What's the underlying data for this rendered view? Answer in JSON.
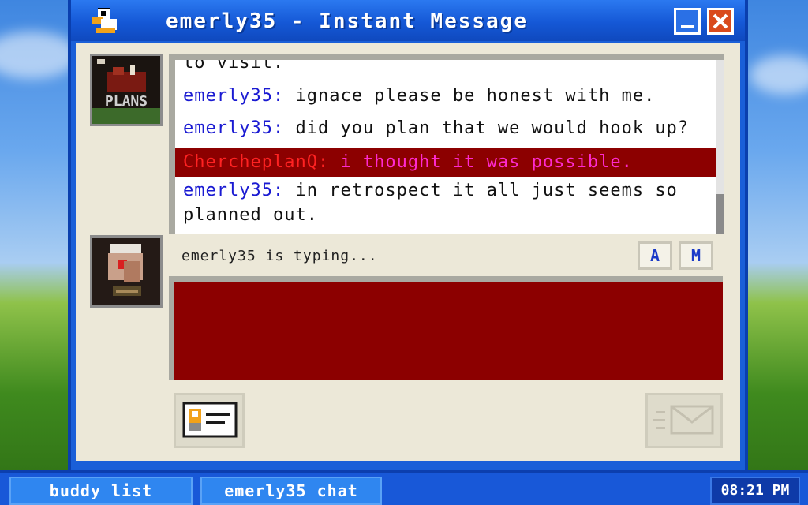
{
  "window": {
    "title": "emerly35 - Instant Message"
  },
  "messages": [
    {
      "sender": "",
      "text": "to visit.",
      "is_partner": false
    },
    {
      "sender": "emerly35:",
      "text": "ignace please be honest with me.",
      "is_partner": false
    },
    {
      "sender": "emerly35:",
      "text": "did you plan that we would hook up?",
      "is_partner": false
    },
    {
      "sender": "ChercheplanQ:",
      "text": "i thought it was possible.",
      "is_partner": true
    },
    {
      "sender": "emerly35:",
      "text": "in retrospect it all just seems so",
      "is_partner": false
    },
    {
      "sender": "",
      "text": "planned out.",
      "is_partner": false
    }
  ],
  "typing": {
    "status": "emerly35 is typing..."
  },
  "format_buttons": {
    "font_label": "A",
    "style_label": "M"
  },
  "avatars": {
    "partner_caption": "PLANS"
  },
  "taskbar": {
    "buddy_list": "buddy list",
    "chat": "emerly35 chat",
    "clock": "08:21 PM"
  },
  "colors": {
    "window_blue": "#1a5fd8",
    "client_bg": "#ece8d8",
    "partner_row": "#8c0000",
    "self_name": "#1a1ad2",
    "partner_name": "#ff2222",
    "partner_text": "#ff2ad0"
  },
  "icons": {
    "title": "duck-icon",
    "profile": "id-card-icon",
    "send": "envelope-send-icon"
  }
}
